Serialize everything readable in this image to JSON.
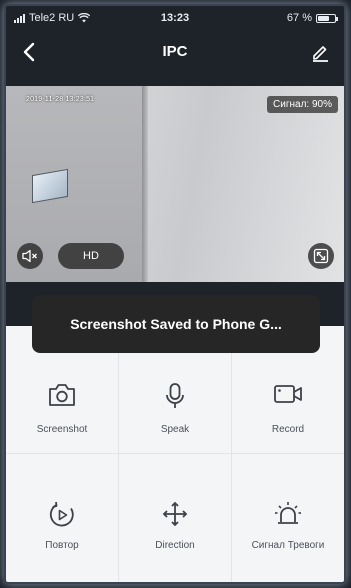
{
  "status_bar": {
    "carrier": "Tele2 RU",
    "time": "13:23",
    "battery": "67 %",
    "battery_level": 0.67
  },
  "nav": {
    "title": "IPC",
    "back_icon": "chevron-left-icon",
    "edit_icon": "pencil-icon"
  },
  "video": {
    "timestamp": "2019-11-28 13:23:51",
    "signal_label": "Сигнал: 90%",
    "quality_label": "HD",
    "mute_icon": "speaker-muted-icon",
    "fullscreen_icon": "fullscreen-icon"
  },
  "toast": {
    "text": "Screenshot Saved to Phone G..."
  },
  "controls": [
    {
      "label": "Screenshot",
      "icon": "camera-icon"
    },
    {
      "label": "Speak",
      "icon": "microphone-icon"
    },
    {
      "label": "Record",
      "icon": "video-camera-icon"
    },
    {
      "label": "Повтор",
      "icon": "playback-icon"
    },
    {
      "label": "Direction",
      "icon": "direction-arrows-icon"
    },
    {
      "label": "Сигнал Тревоги",
      "icon": "alarm-icon"
    }
  ],
  "colors": {
    "background_dark": "#1e2229",
    "panel_bg": "#f4f5f7",
    "toast_bg": "#262626",
    "icon_color": "#3d4148"
  }
}
